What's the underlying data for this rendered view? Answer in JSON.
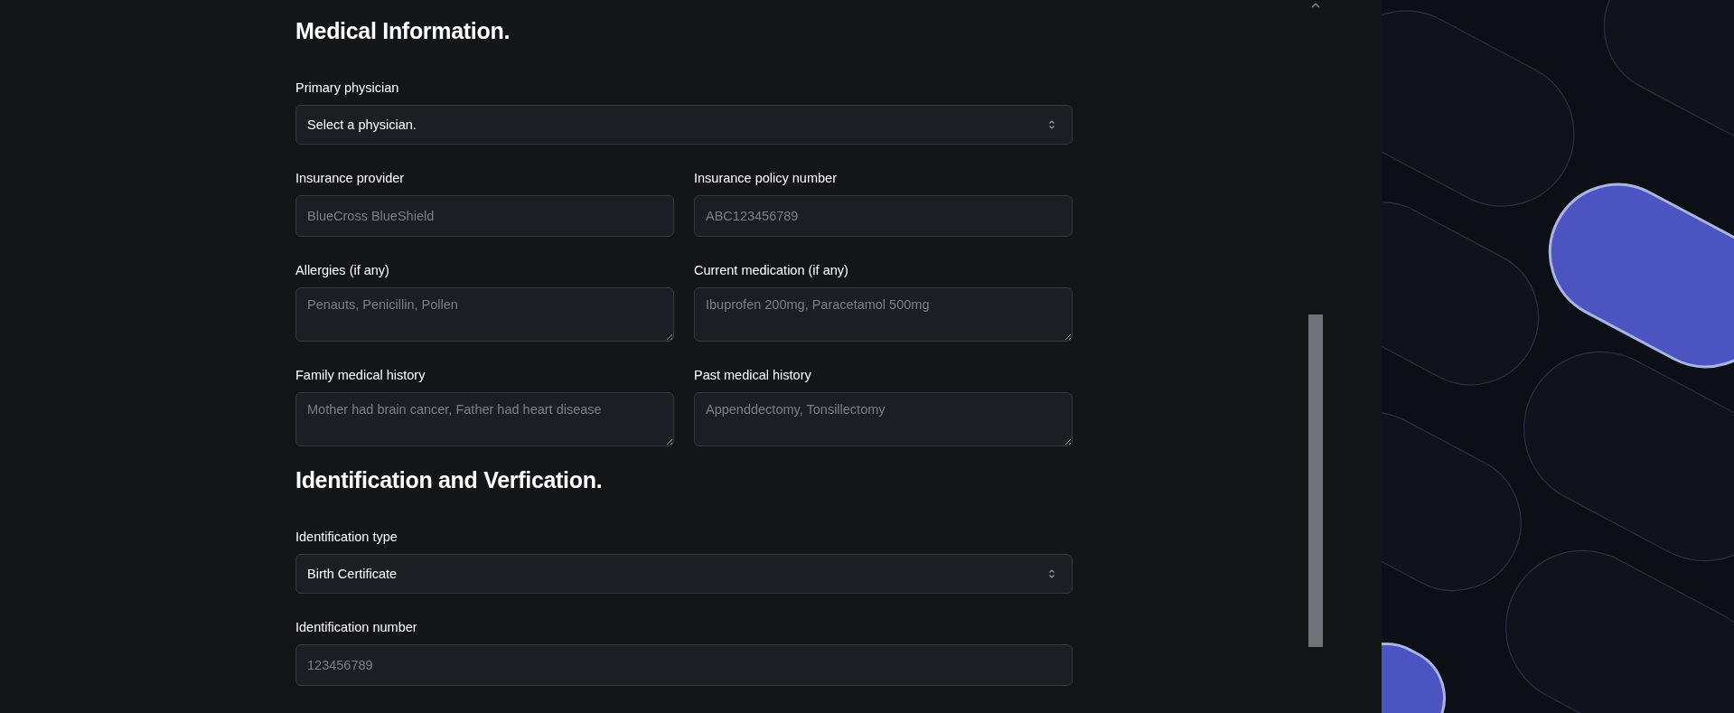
{
  "sections": [
    {
      "title": "Medical Information.",
      "rows": [
        [
          {
            "kind": "select",
            "label": "Primary physician",
            "value": "Select a physician."
          }
        ],
        [
          {
            "kind": "input",
            "label": "Insurance provider",
            "placeholder": "BlueCross BlueShield"
          },
          {
            "kind": "input",
            "label": "Insurance policy number",
            "placeholder": "ABC123456789"
          }
        ],
        [
          {
            "kind": "textarea",
            "label": "Allergies (if any)",
            "placeholder": "Penauts, Penicillin, Pollen"
          },
          {
            "kind": "textarea",
            "label": "Current medication (if any)",
            "placeholder": "Ibuprofen 200mg, Paracetamol 500mg"
          }
        ],
        [
          {
            "kind": "textarea",
            "label": "Family medical history",
            "placeholder": "Mother had brain cancer, Father had heart disease"
          },
          {
            "kind": "textarea",
            "label": "Past medical history",
            "placeholder": "Appenddectomy, Tonsillectomy"
          }
        ]
      ]
    },
    {
      "title": "Identification and Verfication.",
      "rows": [
        [
          {
            "kind": "select",
            "label": "Identification type",
            "value": "Birth Certificate"
          }
        ],
        [
          {
            "kind": "input",
            "label": "Identification number",
            "placeholder": "123456789"
          }
        ]
      ]
    }
  ]
}
